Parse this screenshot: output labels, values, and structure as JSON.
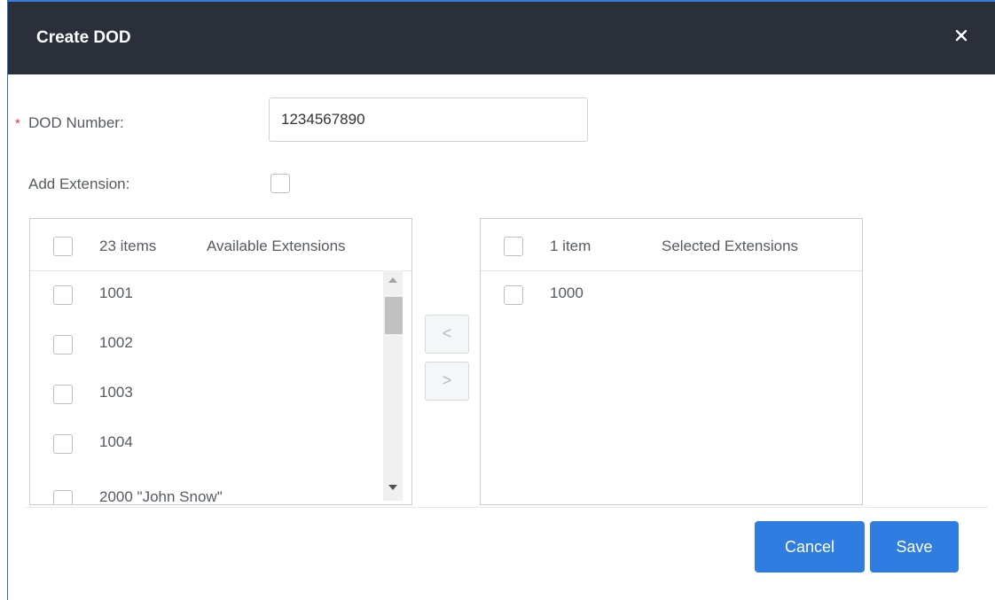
{
  "dialog": {
    "title": "Create DOD",
    "close_icon": "close-icon",
    "accent_color": "#2f7de1",
    "header_bg": "#2b2f3a"
  },
  "form": {
    "dod_number_label": "DOD Number:",
    "required_mark": "*",
    "dod_number_value": "1234567890",
    "add_extension_label": "Add Extension:",
    "add_extension_checked": false
  },
  "available": {
    "count": "23 items",
    "title": "Available Extensions",
    "items": [
      "1001",
      "1002",
      "1003",
      "1004",
      "2000 \"John Snow\""
    ]
  },
  "selected": {
    "count": "1 item",
    "title": "Selected Extensions",
    "items": [
      "1000"
    ]
  },
  "transfer": {
    "move_left": "<",
    "move_right": ">"
  },
  "footer": {
    "cancel_label": "Cancel",
    "save_label": "Save"
  }
}
